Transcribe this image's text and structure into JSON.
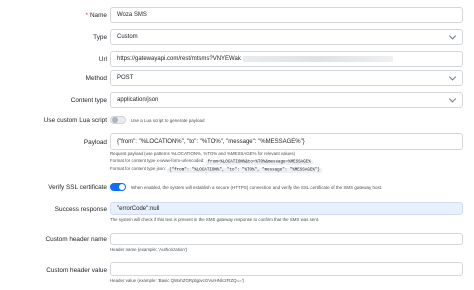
{
  "name": {
    "label": "Name",
    "required": "*",
    "value": "Woza SMS"
  },
  "type": {
    "label": "Type",
    "value": "Custom"
  },
  "url": {
    "label": "Url",
    "value": "https://gatewayapi.com/rest/mtsms?VNYEWak"
  },
  "method": {
    "label": "Method",
    "value": "POST"
  },
  "content_type": {
    "label": "Content type",
    "value": "application/json"
  },
  "lua": {
    "label": "Use custom Lua script",
    "toggle_text": "Use a Lua script to generate payload",
    "enabled": false
  },
  "payload": {
    "label": "Payload",
    "value": "{\"from\": \"%LOCATION%\", \"to\": \"%TO%\", \"message\": \"%MESSAGE%\"}",
    "help1": "Request payload (use patterns %LOCATION%, %TO% and %MESSAGE% for relevant values)",
    "help2_prefix": "Format for content type x-www-form-urlencoded:",
    "help2_code": "from=%LOCATION%&to=%TO%&message=%MESSAGE%",
    "help3_prefix": "Format for content type json:",
    "help3_code": "{\"from\": \"%LOCATION%\", \"to\": \"%TO%\", \"message\": \"%MESSAGE%\"}"
  },
  "ssl": {
    "label": "Verify SSL certificate",
    "toggle_text": "When enabled, the system will establish a secure (HTTPS) connection and verify the SSL certificate of the SMS gateway host.",
    "enabled": true
  },
  "success": {
    "label": "Success response",
    "value": "\"errorCode\":null",
    "help": "The system will check if this text is present in the SMS gateway response to confirm that the SMS was sent."
  },
  "header_name": {
    "label": "Custom header name",
    "value": "",
    "help": "Header name (example: 'Authorization')"
  },
  "header_value": {
    "label": "Custom header value",
    "value": "",
    "help": "Header value (example: 'Basic QWxhZGRpbjpvcGVuIHNlc2FtZQ==')"
  }
}
